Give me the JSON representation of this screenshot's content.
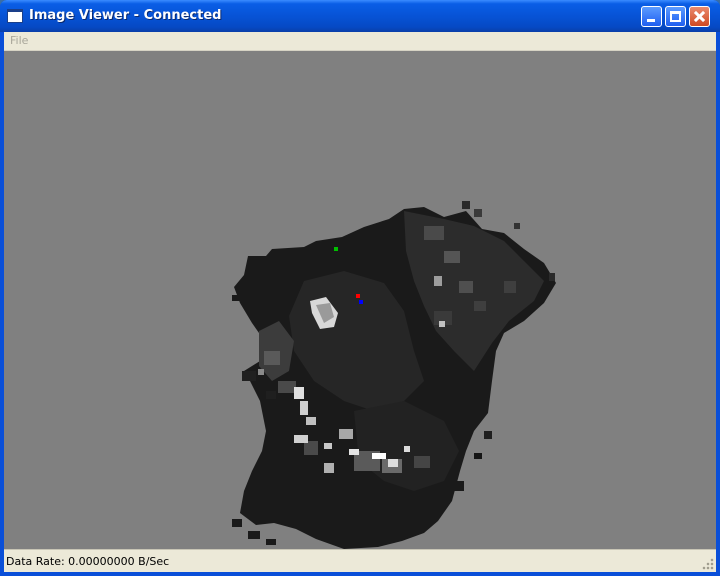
{
  "window": {
    "title": "Image Viewer - Connected",
    "app_icon": "window-icon",
    "controls": {
      "minimize": "minimize-icon",
      "maximize": "maximize-icon",
      "close": "close-icon"
    }
  },
  "menubar": {
    "items": [
      {
        "label": "File",
        "enabled": false
      }
    ]
  },
  "viewer": {
    "background": "#808080",
    "image": "grayscale occupancy map",
    "markers": [
      {
        "name": "green-marker",
        "color": "#00c000"
      },
      {
        "name": "red-marker",
        "color": "#ff0000"
      },
      {
        "name": "blue-marker",
        "color": "#0000ff"
      }
    ]
  },
  "statusbar": {
    "data_rate": "Data Rate: 0.00000000 B/Sec"
  },
  "colors": {
    "titlebar": "#0753d6",
    "chrome": "#ece9d8",
    "close": "#d04a22"
  }
}
